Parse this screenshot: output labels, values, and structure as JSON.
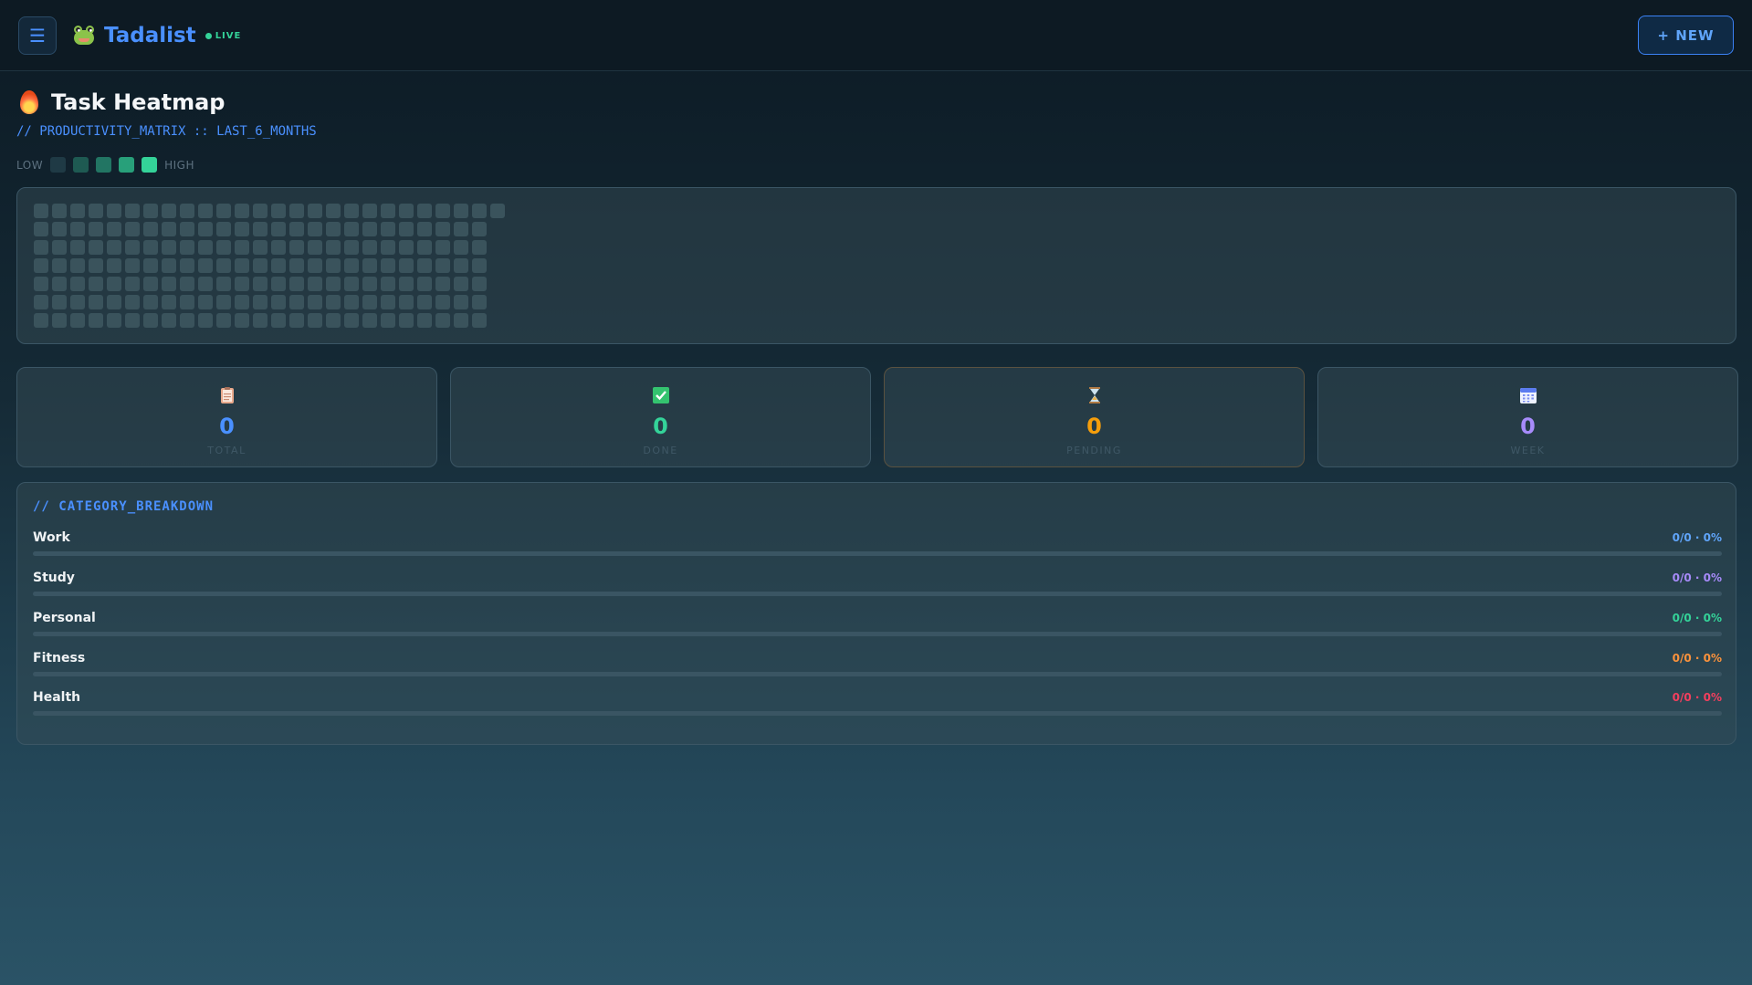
{
  "header": {
    "menu_icon": "hamburger-icon",
    "menu_glyph": "☰",
    "brand_name": "Tadalist",
    "live_label": "LIVE",
    "new_button": "+ NEW"
  },
  "page": {
    "title": "Task Heatmap",
    "subtitle": "// PRODUCTIVITY_MATRIX :: LAST_6_MONTHS",
    "legend_low": "LOW",
    "legend_high": "HIGH",
    "legend_colors": [
      "#1f3a45",
      "#1e5a52",
      "#227563",
      "#28a07a",
      "#34d399"
    ]
  },
  "heatmap": {
    "weeks": 26,
    "days": 7,
    "empty_color": "#3a535c"
  },
  "stats": [
    {
      "key": "total",
      "icon": "clipboard-icon",
      "value": "0",
      "label": "TOTAL",
      "color": "#4a90ff"
    },
    {
      "key": "done",
      "icon": "check-box-icon",
      "value": "0",
      "label": "DONE",
      "color": "#34d399"
    },
    {
      "key": "pending",
      "icon": "hourglass-icon",
      "value": "0",
      "label": "PENDING",
      "color": "#f59e0b"
    },
    {
      "key": "week",
      "icon": "calendar-icon",
      "value": "0",
      "label": "WEEK",
      "color": "#a78bfa"
    }
  ],
  "categories": {
    "heading": "// CATEGORY_BREAKDOWN",
    "items": [
      {
        "name": "Work",
        "stat": "0/0 · 0%",
        "progress": 0,
        "color": "#60a5fa"
      },
      {
        "name": "Study",
        "stat": "0/0 · 0%",
        "progress": 0,
        "color": "#a78bfa"
      },
      {
        "name": "Personal",
        "stat": "0/0 · 0%",
        "progress": 0,
        "color": "#34d399"
      },
      {
        "name": "Fitness",
        "stat": "0/0 · 0%",
        "progress": 0,
        "color": "#fb923c"
      },
      {
        "name": "Health",
        "stat": "0/0 · 0%",
        "progress": 0,
        "color": "#f43f5e"
      }
    ]
  }
}
